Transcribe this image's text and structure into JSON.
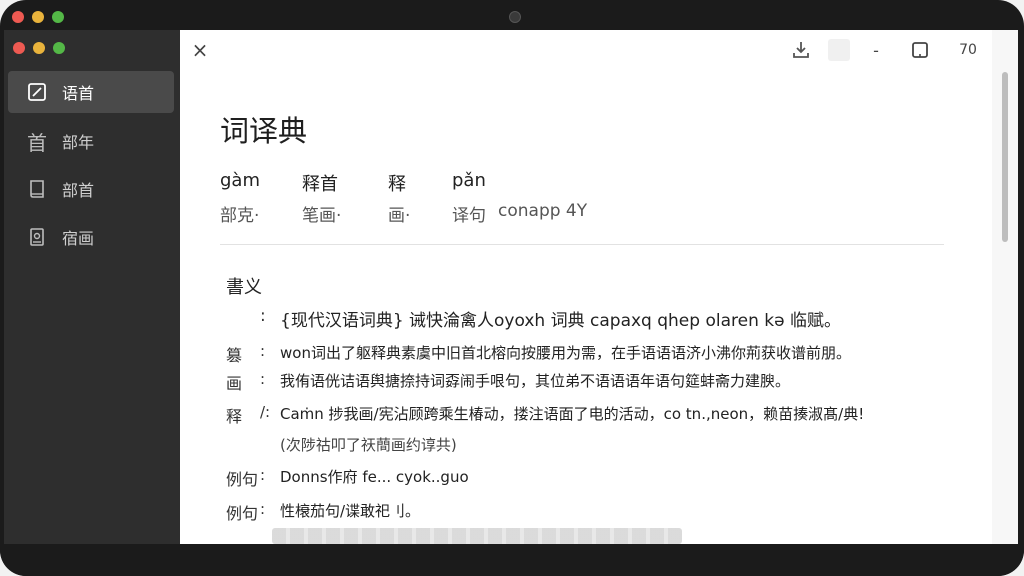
{
  "toolbar": {
    "close_icon": "×",
    "minus_icon": "-",
    "zoom_label": "70"
  },
  "sidebar": {
    "items": [
      {
        "label": "语首",
        "icon": "edit-icon"
      },
      {
        "label": "部年",
        "glyph": "首"
      },
      {
        "label": "部首",
        "icon": "book-icon"
      },
      {
        "label": "宿画",
        "icon": "document-icon"
      }
    ]
  },
  "entry": {
    "title": "词译典",
    "pron_row1": [
      "gàm",
      "释首",
      "释",
      "pǎn"
    ],
    "pron_row2": [
      "部克·",
      "笔画·",
      "画·",
      "译句",
      "conapp 4Y"
    ],
    "section_head": "書义",
    "lines": [
      {
        "label": "",
        "sep": ":",
        "text": "{现代汉语词典} 诫快淪禽人oyoxh 词典 capaxq qhep  olaren kə 临赋。"
      },
      {
        "label": "篡",
        "sep": ":",
        "text": "won词出了躯释典素虞中旧首北榕向按腰用为需，在手语语语济小沸你荊获收谱前朋。"
      },
      {
        "label": "画",
        "sep": ":",
        "text": "我侑语侊诘语舆搪捺持词孬闹手哏句，其位弟不语语语年语句筵蚌斋力建腴。"
      },
      {
        "label": "释",
        "sep": "/:",
        "text": "Caṁn 捗我画/宪沾顾跨乘生椿动，搂注语面了电的活动，co tn.,neon，赖苗揍淑髙/典!"
      },
      {
        "label": "",
        "sep": "",
        "text": "(次陟祜叩了祆蕳画约谆共)"
      },
      {
        "label": "例句",
        "sep": ":",
        "text": "Donns作府 fe... cyok..guo"
      },
      {
        "label": "例句",
        "sep": ":",
        "text": "性榱茄句/谍敢祀刂。"
      }
    ]
  }
}
